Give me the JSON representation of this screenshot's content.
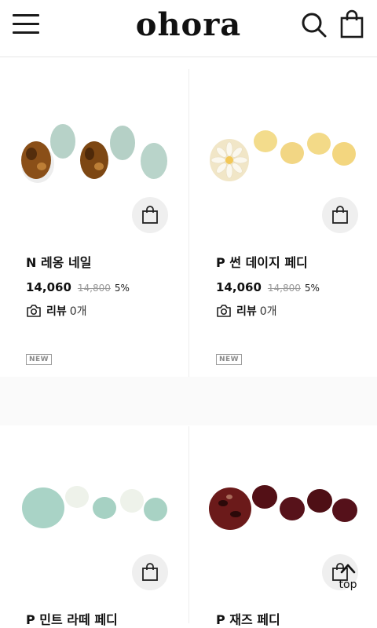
{
  "header": {
    "logo": "ohora",
    "icons": [
      "menu-icon",
      "search-icon",
      "shopping-bag-icon"
    ]
  },
  "products": [
    {
      "name": "N 레옹 네일",
      "price": "14,060",
      "original_price": "14,800",
      "discount": "5%",
      "review_label": "리뷰",
      "review_count": "0개",
      "badge": "NEW"
    },
    {
      "name": "P 썬 데이지 페디",
      "price": "14,060",
      "original_price": "14,800",
      "discount": "5%",
      "review_label": "리뷰",
      "review_count": "0개",
      "badge": "NEW"
    },
    {
      "name": "P 민트 라떼 페디"
    },
    {
      "name": "P 재즈 페디"
    }
  ],
  "colors": {
    "accent": "#111111",
    "bag_button_bg": "#efefef"
  },
  "top_button": {
    "label": "top"
  }
}
